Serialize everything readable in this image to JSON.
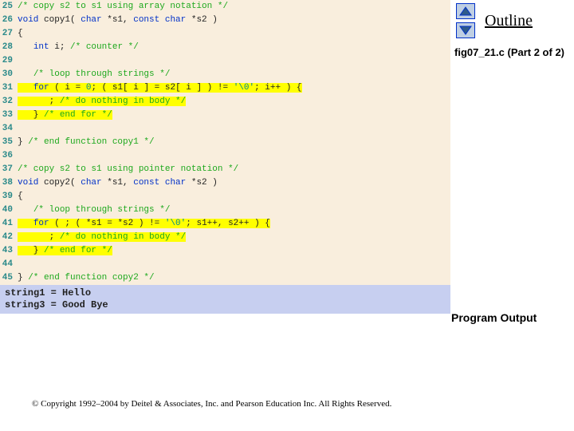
{
  "code": {
    "lines": [
      {
        "n": 25,
        "hl": false,
        "segs": [
          {
            "c": "comment",
            "t": "/* copy s2 to s1 using array notation */"
          }
        ]
      },
      {
        "n": 26,
        "hl": false,
        "segs": [
          {
            "c": "kw",
            "t": "void"
          },
          {
            "c": "plain",
            "t": " copy1( "
          },
          {
            "c": "kw",
            "t": "char"
          },
          {
            "c": "plain",
            "t": " *s1, "
          },
          {
            "c": "kw",
            "t": "const char"
          },
          {
            "c": "plain",
            "t": " *s2 )"
          }
        ]
      },
      {
        "n": 27,
        "hl": false,
        "segs": [
          {
            "c": "plain",
            "t": "{"
          }
        ]
      },
      {
        "n": 28,
        "hl": false,
        "segs": [
          {
            "c": "plain",
            "t": "   "
          },
          {
            "c": "kw",
            "t": "int"
          },
          {
            "c": "plain",
            "t": " i; "
          },
          {
            "c": "comment",
            "t": "/* counter */"
          }
        ]
      },
      {
        "n": 29,
        "hl": false,
        "segs": [
          {
            "c": "plain",
            "t": ""
          }
        ]
      },
      {
        "n": 30,
        "hl": false,
        "segs": [
          {
            "c": "plain",
            "t": "   "
          },
          {
            "c": "comment",
            "t": "/* loop through strings */"
          }
        ]
      },
      {
        "n": 31,
        "hl": true,
        "segs": [
          {
            "c": "plain",
            "t": "   "
          },
          {
            "c": "kw",
            "t": "for"
          },
          {
            "c": "plain",
            "t": " ( i = "
          },
          {
            "c": "str",
            "t": "0"
          },
          {
            "c": "plain",
            "t": "; ( s1[ i ] = s2[ i ] ) != "
          },
          {
            "c": "str",
            "t": "'\\0'"
          },
          {
            "c": "plain",
            "t": "; i++ ) {"
          }
        ]
      },
      {
        "n": 32,
        "hl": true,
        "segs": [
          {
            "c": "plain",
            "t": "      ; "
          },
          {
            "c": "comment",
            "t": "/* do nothing in body */"
          }
        ]
      },
      {
        "n": 33,
        "hl": true,
        "segs": [
          {
            "c": "plain",
            "t": "   } "
          },
          {
            "c": "comment",
            "t": "/* end for */"
          }
        ]
      },
      {
        "n": 34,
        "hl": false,
        "segs": [
          {
            "c": "plain",
            "t": ""
          }
        ]
      },
      {
        "n": 35,
        "hl": false,
        "segs": [
          {
            "c": "plain",
            "t": "} "
          },
          {
            "c": "comment",
            "t": "/* end function copy1 */"
          }
        ]
      },
      {
        "n": 36,
        "hl": false,
        "segs": [
          {
            "c": "plain",
            "t": ""
          }
        ]
      },
      {
        "n": 37,
        "hl": false,
        "segs": [
          {
            "c": "comment",
            "t": "/* copy s2 to s1 using pointer notation */"
          }
        ]
      },
      {
        "n": 38,
        "hl": false,
        "segs": [
          {
            "c": "kw",
            "t": "void"
          },
          {
            "c": "plain",
            "t": " copy2( "
          },
          {
            "c": "kw",
            "t": "char"
          },
          {
            "c": "plain",
            "t": " *s1, "
          },
          {
            "c": "kw",
            "t": "const char"
          },
          {
            "c": "plain",
            "t": " *s2 )"
          }
        ]
      },
      {
        "n": 39,
        "hl": false,
        "segs": [
          {
            "c": "plain",
            "t": "{"
          }
        ]
      },
      {
        "n": 40,
        "hl": false,
        "segs": [
          {
            "c": "plain",
            "t": "   "
          },
          {
            "c": "comment",
            "t": "/* loop through strings */"
          }
        ]
      },
      {
        "n": 41,
        "hl": true,
        "segs": [
          {
            "c": "plain",
            "t": "   "
          },
          {
            "c": "kw",
            "t": "for"
          },
          {
            "c": "plain",
            "t": " ( ; ( *s1 = *s2 ) != "
          },
          {
            "c": "str",
            "t": "'\\0'"
          },
          {
            "c": "plain",
            "t": "; s1++, s2++ ) {"
          }
        ]
      },
      {
        "n": 42,
        "hl": true,
        "segs": [
          {
            "c": "plain",
            "t": "      ; "
          },
          {
            "c": "comment",
            "t": "/* do nothing in body */"
          }
        ]
      },
      {
        "n": 43,
        "hl": true,
        "segs": [
          {
            "c": "plain",
            "t": "   } "
          },
          {
            "c": "comment",
            "t": "/* end for */"
          }
        ]
      },
      {
        "n": 44,
        "hl": false,
        "segs": [
          {
            "c": "plain",
            "t": ""
          }
        ]
      },
      {
        "n": 45,
        "hl": false,
        "segs": [
          {
            "c": "plain",
            "t": "} "
          },
          {
            "c": "comment",
            "t": "/* end function copy2 */"
          }
        ]
      }
    ]
  },
  "output": {
    "line1": "string1 = Hello",
    "line2": "string3 = Good Bye"
  },
  "sidebar": {
    "outline_label": "Outline",
    "file_label": "fig07_21.c (Part 2 of 2)",
    "program_output_label": "Program Output"
  },
  "copyright": "© Copyright 1992–2004 by Deitel & Associates, Inc. and Pearson Education Inc. All Rights Reserved."
}
